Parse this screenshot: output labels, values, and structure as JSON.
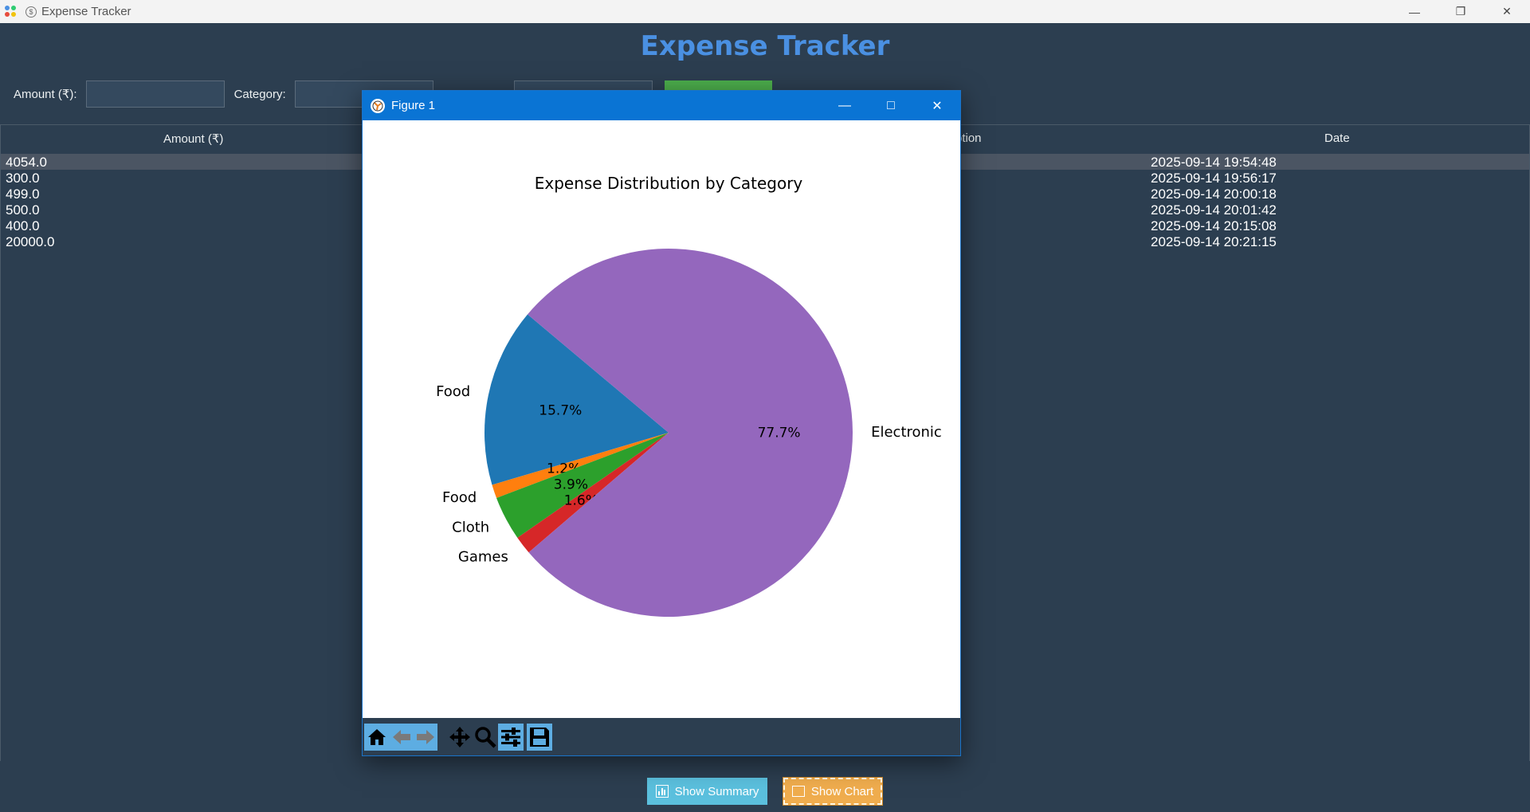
{
  "window": {
    "title": "Expense Tracker",
    "minimize_icon": "minimize-icon",
    "maximize_icon": "restore-icon",
    "close_icon": "close-icon"
  },
  "app": {
    "heading": "Expense Tracker",
    "form": {
      "amount_label": "Amount (₹):",
      "amount_value": "",
      "category_label": "Category:",
      "category_value": ""
    },
    "table": {
      "columns": [
        "Amount (₹)",
        "ption",
        "Date"
      ],
      "rows": [
        {
          "amount": "4054.0",
          "date": "2025-09-14 19:54:48",
          "selected": true
        },
        {
          "amount": "300.0",
          "date": "2025-09-14 19:56:17",
          "selected": false
        },
        {
          "amount": "499.0",
          "date": "2025-09-14 20:00:18",
          "selected": false
        },
        {
          "amount": "500.0",
          "date": "2025-09-14 20:01:42",
          "selected": false
        },
        {
          "amount": "400.0",
          "date": "2025-09-14 20:15:08",
          "selected": false
        },
        {
          "amount": "20000.0",
          "date": "2025-09-14 20:21:15",
          "selected": false
        }
      ]
    },
    "buttons": {
      "summary": "Show Summary",
      "chart": "Show Chart"
    }
  },
  "figure": {
    "title": "Figure 1",
    "toolbar": [
      "home-icon",
      "back-icon",
      "forward-icon",
      "pan-icon",
      "zoom-icon",
      "configure-icon",
      "save-icon"
    ]
  },
  "chart_data": {
    "type": "pie",
    "title": "Expense Distribution by Category",
    "labels": [
      "Food",
      "Food",
      "Cloth",
      "Games",
      "Electronic"
    ],
    "values": [
      15.7,
      1.2,
      3.9,
      1.6,
      77.7
    ],
    "autopct_labels": [
      "15.7%",
      "1.2%",
      "3.9%",
      "1.6%",
      "77.7%"
    ],
    "colors": [
      "#1f77b4",
      "#ff7f0e",
      "#2ca02c",
      "#d62728",
      "#9467bd"
    ],
    "start_angle_deg": 140
  },
  "colors": {
    "background": "#2c3e50",
    "heading": "#4a90e2",
    "summary_button": "#5bc0de",
    "chart_button": "#f0ad4e",
    "figure_titlebar": "#0a74d4"
  }
}
